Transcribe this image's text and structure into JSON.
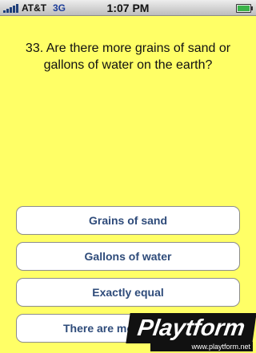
{
  "status_bar": {
    "carrier": "AT&T",
    "network": "3G",
    "time": "1:07 PM",
    "signal_bars": 5,
    "battery_level": 1.0
  },
  "question": {
    "text": "33. Are there more grains of sand or gallons of water on the earth?"
  },
  "answers": [
    {
      "label": "Grains of sand"
    },
    {
      "label": "Gallons of water"
    },
    {
      "label": "Exactly equal"
    },
    {
      "label": "There are mo"
    }
  ],
  "watermark": {
    "logo": "Playtform",
    "url": "www.playtform.net"
  },
  "colors": {
    "background": "#ffff66",
    "answer_text": "#2e4b7a"
  }
}
